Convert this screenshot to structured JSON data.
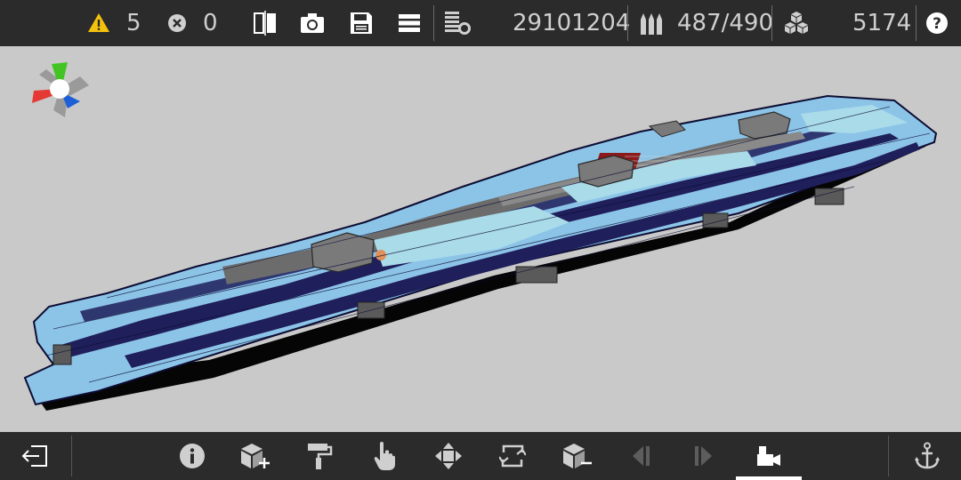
{
  "topbar": {
    "warnings_count": "5",
    "errors_count": "0",
    "cost_value": "29101204",
    "ammo_value": "487/490",
    "blocks_value": "5174",
    "icons": [
      "warning-icon",
      "error-icon",
      "mirror-icon",
      "camera-icon",
      "save-icon",
      "menu-icon",
      "stats-icon",
      "ammo-icon",
      "blocks-icon",
      "help-icon"
    ]
  },
  "bottombar": {
    "icons": [
      "exit-icon",
      "info-icon",
      "add-block-icon",
      "paint-roller-icon",
      "hand-pointer-icon",
      "move-icon",
      "rotate-icon",
      "remove-block-icon",
      "previous-icon",
      "next-icon",
      "camera-mode-icon",
      "anchor-icon"
    ],
    "active_tool": "camera-mode-icon"
  },
  "colors": {
    "bar_bg": "#2b2b2b",
    "viewport_bg": "#c9c9c9",
    "hull_light": "#8cc4e8",
    "hull_dark": "#1f1f5c",
    "accent_warning": "#f4c20d",
    "axis_x": "#e53935",
    "axis_y": "#43c423",
    "axis_z": "#1e5fd8"
  }
}
